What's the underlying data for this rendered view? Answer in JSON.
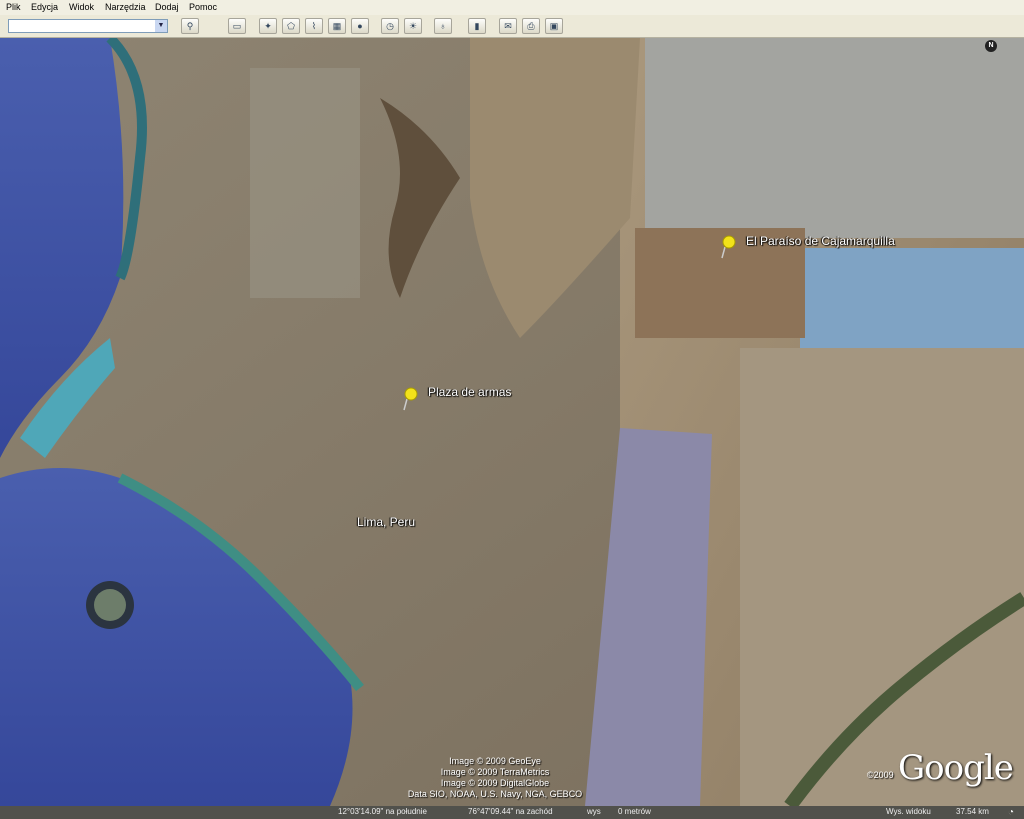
{
  "menu": {
    "items": [
      "Plik",
      "Edycja",
      "Widok",
      "Narzędzia",
      "Dodaj",
      "Pomoc"
    ]
  },
  "toolbar": {
    "search_value": "",
    "buttons": [
      "sidebar-icon",
      "placemark-icon",
      "polygon-icon",
      "path-icon",
      "image-overlay-icon",
      "record-tour-icon",
      "historical-imagery-icon",
      "sunlight-icon",
      "planets-icon",
      "ruler-icon",
      "email-icon",
      "print-icon",
      "save-image-icon"
    ]
  },
  "map": {
    "compass_label": "N",
    "placemarks": [
      {
        "label": "El Paraíso de Cajamarquilla",
        "icon": "pushpin-icon"
      },
      {
        "label": "Plaza de armas",
        "icon": "pushpin-icon"
      }
    ],
    "city_label": "Lima, Peru",
    "credits": [
      "Image © 2009 GeoEye",
      "Image © 2009 TerraMetrics",
      "Image © 2009 DigitalGlobe",
      "Data SIO, NOAA, U.S. Navy, NGA, GEBCO"
    ],
    "google_year": "©2009",
    "google_logo": "Google"
  },
  "status": {
    "latitude": "12°03'14.09\" na południe",
    "longitude": "76°47'09.44\" na zachód",
    "elevation_label": "wys",
    "elevation_value": "0 metrów",
    "eye_alt_label": "Wys. widoku",
    "eye_alt_value": "37.54 km"
  },
  "colors": {
    "ocean": "#3c4f9a",
    "land": "#8a7a62",
    "mountains": "#9c8c74",
    "pin": "#f2e21a"
  }
}
